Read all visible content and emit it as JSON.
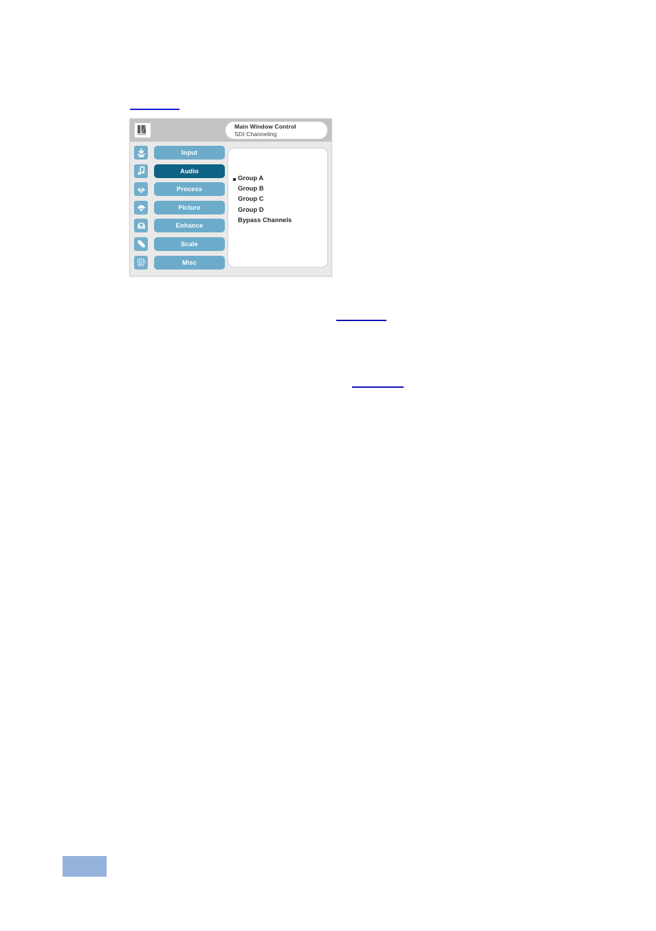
{
  "page": {
    "page_number_highlight": "",
    "link_marks": [
      "",
      "",
      ""
    ]
  },
  "osd": {
    "brand": "kramer-logo",
    "header": {
      "title": "Main Window Control",
      "subtitle": "SDI Channeling"
    },
    "menu": [
      {
        "label": "Input",
        "icon": "input-tray-arrow-icon",
        "active": false
      },
      {
        "label": "Audio",
        "icon": "music-note-icon",
        "active": true
      },
      {
        "label": "Process",
        "icon": "process-lamp-icon",
        "active": false
      },
      {
        "label": "Picture",
        "icon": "picture-lamp-icon",
        "active": false
      },
      {
        "label": "Enhance",
        "icon": "enhance-arrow-up-icon",
        "active": false
      },
      {
        "label": "Scale",
        "icon": "scale-diagonal-arrow-icon",
        "active": false
      },
      {
        "label": "Misc",
        "icon": "misc-dot-grid-icon",
        "active": false
      }
    ],
    "content": {
      "options": [
        {
          "label": "Group A",
          "selected": true
        },
        {
          "label": "Group B",
          "selected": false
        },
        {
          "label": "Group C",
          "selected": false
        },
        {
          "label": "Group D",
          "selected": false
        },
        {
          "label": "Bypass Channels",
          "selected": false
        }
      ]
    }
  },
  "colors": {
    "menu_button": "#6cacca",
    "menu_button_active": "#0f6384",
    "menu_icon_bg": "#73aecb",
    "panel_bg": "#e9e9e9",
    "header_bg": "#c3c3c3",
    "link_underline": "#1818d8",
    "page_number_highlight": "#94b3da"
  }
}
